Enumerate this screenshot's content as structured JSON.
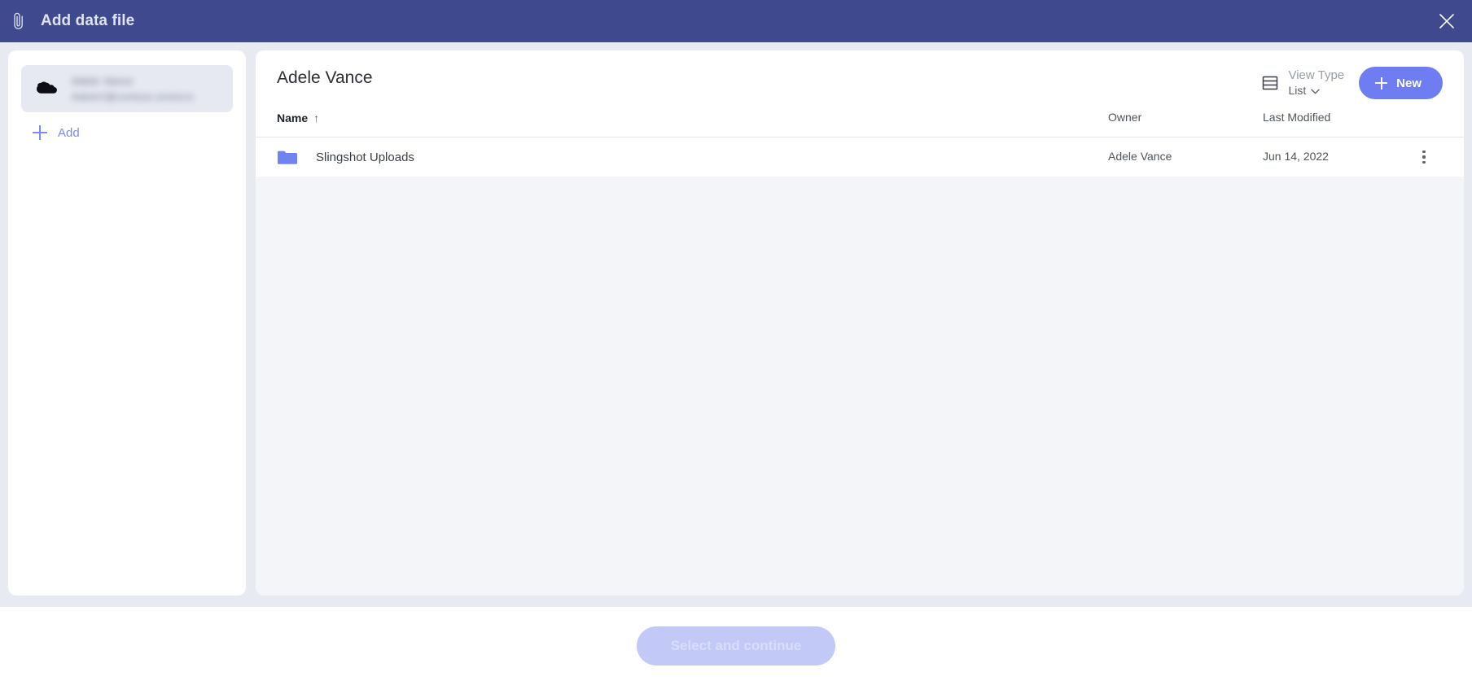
{
  "titlebar": {
    "title": "Add data file",
    "attach_icon": "paperclip-icon",
    "close_icon": "close-icon",
    "background": "#3f498d"
  },
  "sidebar": {
    "account": {
      "provider_icon": "onedrive-cloud-icon",
      "name_redacted": "Adele Vance",
      "email_redacted": "AdeleV@contoso.onmicrosoft.com",
      "selected": true
    },
    "add": {
      "label": "Add",
      "icon": "plus-icon",
      "color": "#7b8bf5"
    }
  },
  "main": {
    "panel_title": "Adele Vance",
    "view_type": {
      "label": "View Type",
      "value": "List",
      "icon": "list-view-icon",
      "chevron": "chevron-down-icon"
    },
    "new_button": {
      "label": "New",
      "icon": "plus-icon",
      "color": "#6e7ef2"
    },
    "table": {
      "columns": [
        {
          "key": "name",
          "label": "Name",
          "sorted": true,
          "sort_icon": "arrow-up-icon"
        },
        {
          "key": "owner",
          "label": "Owner",
          "sorted": false
        },
        {
          "key": "modified",
          "label": "Last Modified",
          "sorted": false
        }
      ],
      "rows": [
        {
          "icon": "folder-icon",
          "icon_color": "#6e7ef2",
          "name": "Slingshot Uploads",
          "owner": "Adele Vance",
          "modified": "Jun 14, 2022",
          "menu_icon": "kebab-menu-icon"
        }
      ]
    }
  },
  "footer": {
    "primary_button": {
      "label": "Select and continue",
      "disabled": true,
      "background": "#c3c9f7"
    }
  }
}
